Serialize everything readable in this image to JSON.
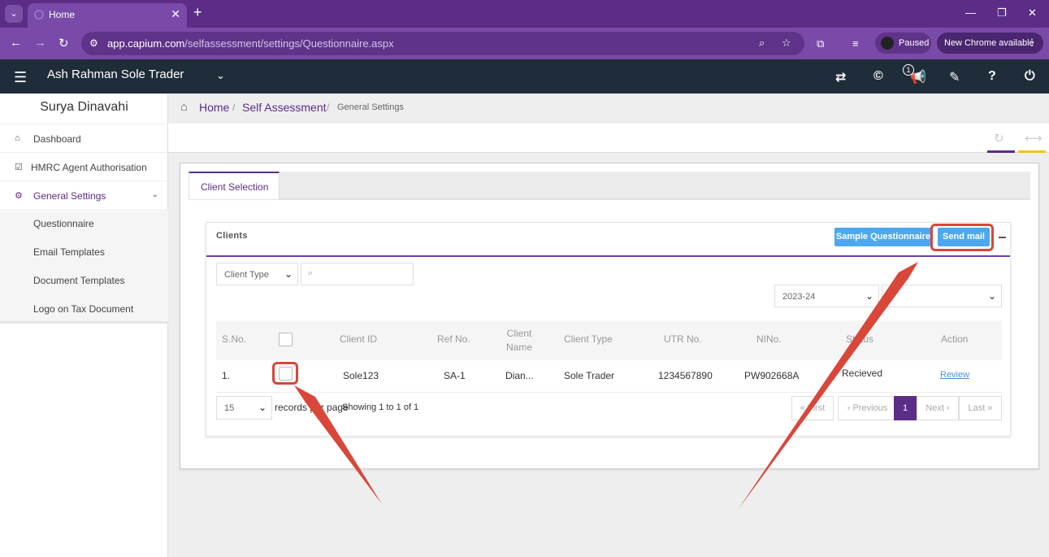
{
  "browser": {
    "tab_title": "Home",
    "url_host": "app.capium.com",
    "url_path": "/selfassessment/settings/Questionnaire.aspx",
    "paused_label": "Paused",
    "update_label": "New Chrome available"
  },
  "header": {
    "company": "Ash Rahman Sole Trader",
    "notification_count": "1"
  },
  "sidebar": {
    "user_name": "Surya Dinavahi",
    "items": [
      {
        "label": "Dashboard",
        "icon": "home-icon"
      },
      {
        "label": "HMRC Agent Authorisation",
        "icon": "check-square-icon"
      },
      {
        "label": "General Settings",
        "icon": "gears-icon"
      }
    ],
    "submenu": [
      {
        "label": "Questionnaire"
      },
      {
        "label": "Email Templates"
      },
      {
        "label": "Document Templates"
      },
      {
        "label": "Logo on Tax Document"
      }
    ]
  },
  "breadcrumb": {
    "home": "Home",
    "sep": "/",
    "section": "Self Assessment",
    "current": "General Settings"
  },
  "panel": {
    "tab_label": "Client Selection",
    "clients_title": "Clients",
    "sample_btn": "Sample Questionnaire",
    "send_btn": "Send mail",
    "client_type_placeholder": "Client Type",
    "year_value": "2023-24",
    "columns": [
      "S.No.",
      "Client ID",
      "Ref No.",
      "Client\nName",
      "Client Type",
      "UTR No.",
      "NINo.",
      "Status",
      "Action"
    ],
    "row": {
      "sno": "1.",
      "client_id": "Sole123",
      "ref_no": "SA-1",
      "client_name": "Dian...",
      "client_type": "Sole Trader",
      "utr": "1234567890",
      "nino": "PW902668A",
      "status": "Recieved",
      "action": "Review"
    },
    "page_size": "15",
    "records_label": "records per page",
    "showing": "Showing 1 to 1 of 1",
    "pager": {
      "first": "« First",
      "prev": "‹ Previous",
      "current": "1",
      "next": "Next ›",
      "last": "Last »"
    }
  },
  "colors": {
    "brand_purple": "#5b2d86",
    "button_blue": "#4da8ee",
    "annotation_red": "#d9463a",
    "accent_yellow": "#f5c518"
  }
}
